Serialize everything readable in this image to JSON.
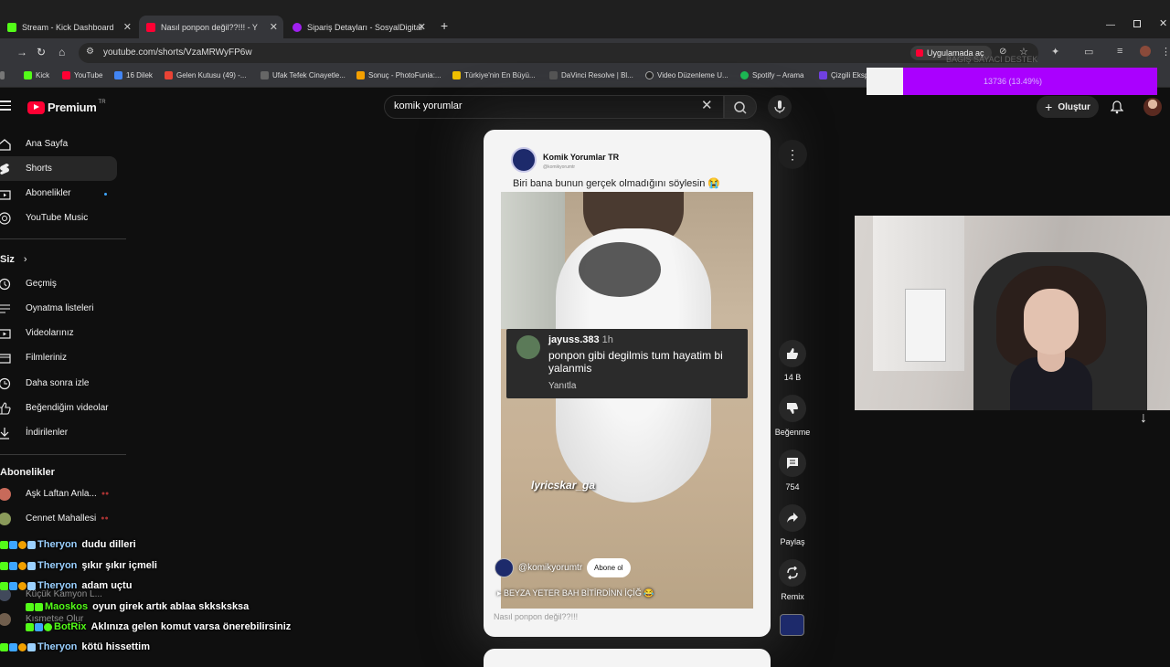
{
  "browser": {
    "tabs": [
      {
        "label": "Stream - Kick Dashboard",
        "color": "#53fc18"
      },
      {
        "label": "Nasıl ponpon değil??!!! - Y",
        "color": "#ff0033"
      },
      {
        "label": "Sipariş Detayları - SosyalDigital",
        "color": "#a020f0"
      }
    ],
    "url": "youtube.com/shorts/VzaMRWyFP6w",
    "app_open_label": "Uygulamada aç",
    "bookmarks": [
      {
        "label": "Kick",
        "color": "#53fc18"
      },
      {
        "label": "YouTube",
        "color": "#ff0033"
      },
      {
        "label": "16 Dilek",
        "color": "#4285f4"
      },
      {
        "label": "Gelen Kutusu (49) -...",
        "color": "#ea4335"
      },
      {
        "label": "Ufak Tefek Cinayetle...",
        "color": "#666666"
      },
      {
        "label": "Sonuç - PhotoFunia:...",
        "color": "#f4a000"
      },
      {
        "label": "Türkiye'nin En Büyü...",
        "color": "#f0c000"
      },
      {
        "label": "DaVinci Resolve | Bl...",
        "color": "#555555"
      },
      {
        "label": "Video Düzenleme U...",
        "color": "#222222"
      },
      {
        "label": "Spotify – Arama",
        "color": "#1db954"
      },
      {
        "label": "Çizgili Eksp",
        "color": "#7040e0"
      }
    ]
  },
  "youtube": {
    "logo": "Premium",
    "logo_region": "TR",
    "search_query": "komik yorumlar",
    "create_label": "Oluştur",
    "sidebar": {
      "main": [
        {
          "label": "Ana Sayfa",
          "icon": "home-icon"
        },
        {
          "label": "Shorts",
          "icon": "shorts-icon"
        },
        {
          "label": "Abonelikler",
          "icon": "subscriptions-icon"
        },
        {
          "label": "YouTube Music",
          "icon": "music-icon"
        }
      ],
      "you_header": "Siz",
      "you": [
        {
          "label": "Geçmiş",
          "icon": "history-icon"
        },
        {
          "label": "Oynatma listeleri",
          "icon": "playlist-icon"
        },
        {
          "label": "Videolarınız",
          "icon": "video-icon"
        },
        {
          "label": "Filmleriniz",
          "icon": "movie-icon"
        },
        {
          "label": "Daha sonra izle",
          "icon": "clock-icon"
        },
        {
          "label": "Beğendiğim videolar",
          "icon": "like-icon"
        },
        {
          "label": "İndirilenler",
          "icon": "download-icon"
        }
      ],
      "subs_header": "Abonelikler",
      "subs": [
        {
          "label": "Aşk Laftan Anla..."
        },
        {
          "label": "Cennet Mahallesi"
        },
        {
          "label": "Küçük Kamyon L..."
        },
        {
          "label": "Kısmetse Olur"
        }
      ]
    },
    "short": {
      "channel_name": "Komik Yorumlar TR",
      "channel_handle": "@komikyorumtr",
      "caption": "Biri bana bunun gerçek olmadığını söylesin 😭",
      "comment": {
        "user": "jayuss.383",
        "time": "1h",
        "text": "ponpon gibi degilmis tum hayatim bi yalanmis",
        "reply": "Yanıtla"
      },
      "watermark": "lyricskar_ga",
      "overlay_handle": "@komikyorumtr",
      "subscribe_label": "Abone ol",
      "music": "BEYZA YETER BAH BİTİRDİNN İÇİĞ 😂",
      "title": "Nasıl ponpon değil??!!!"
    },
    "actions": {
      "like_count": "14 B",
      "dislike_label": "Beğenme",
      "comment_count": "754",
      "share_label": "Paylaş",
      "remix_label": "Remix"
    }
  },
  "stream": {
    "donation_title": "BAĞIŞ SAYACI DESTEK",
    "donation_text": "13736 (13.49%)",
    "chat": [
      {
        "user": "Theryon",
        "message": "dudu dilleri",
        "user_color": "#9ad0ff"
      },
      {
        "user": "Theryon",
        "message": "şıkır şıkır içmeli",
        "user_color": "#9ad0ff"
      },
      {
        "user": "Theryon",
        "message": "adam uçtu",
        "user_color": "#9ad0ff"
      },
      {
        "user": "Maoskos",
        "message": "oyun girek artık ablaa skksksksa",
        "user_color": "#53fc18"
      },
      {
        "user": "BotRix",
        "message": "Aklınıza gelen komut varsa önerebilirsiniz",
        "user_color": "#53fc18"
      },
      {
        "user": "Theryon",
        "message": "kötü hissettim",
        "user_color": "#9ad0ff"
      }
    ]
  }
}
